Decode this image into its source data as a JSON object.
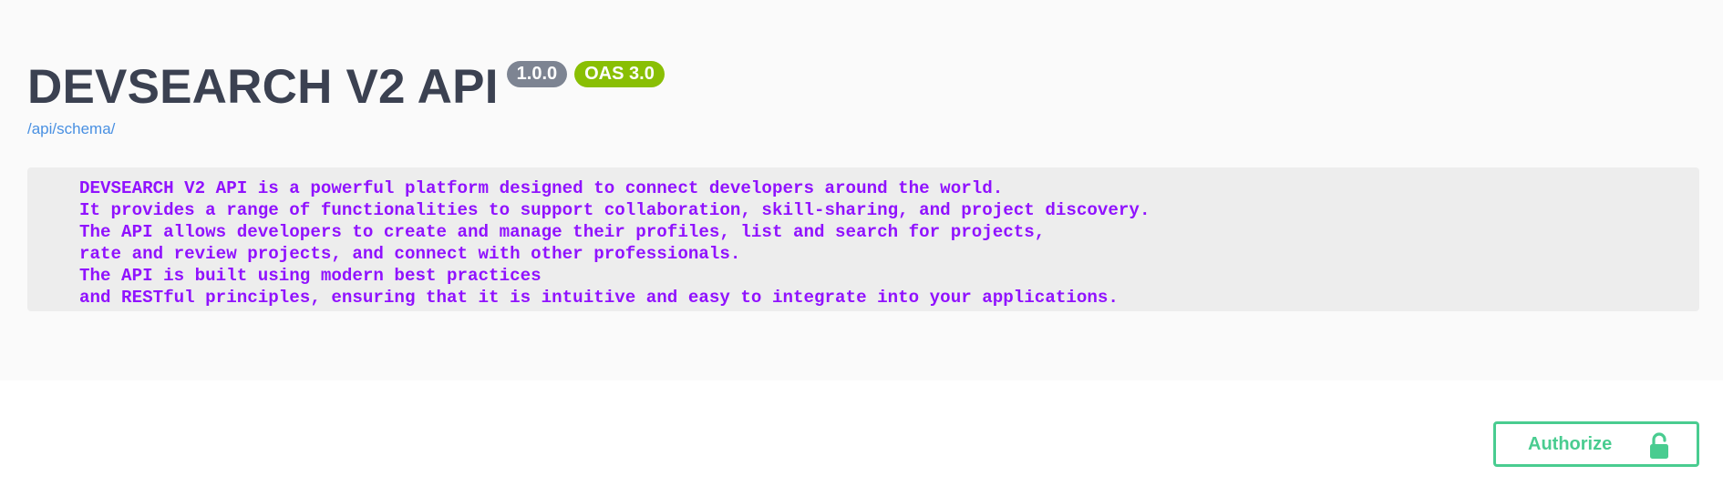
{
  "info": {
    "title": "DEVSEARCH V2 API",
    "version_badge": "1.0.0",
    "oas_badge": "OAS 3.0",
    "schema_link": "/api/schema/",
    "description_lines": [
      "DEVSEARCH V2 API is a powerful platform designed to connect developers around the world.",
      "It provides a range of functionalities to support collaboration, skill-sharing, and project discovery.",
      "The API allows developers to create and manage their profiles, list and search for projects,",
      "rate and review projects, and connect with other professionals.",
      "The API is built using modern best practices",
      "and RESTful principles, ensuring that it is intuitive and easy to integrate into your applications."
    ]
  },
  "auth": {
    "authorize_label": "Authorize",
    "icon": "unlocked-padlock-icon"
  },
  "colors": {
    "title": "#3b4151",
    "version_badge": "#7d8492",
    "oas_badge": "#89bf04",
    "link": "#4990e2",
    "description_text": "#9012fe",
    "authorize_accent": "#49cc90"
  }
}
